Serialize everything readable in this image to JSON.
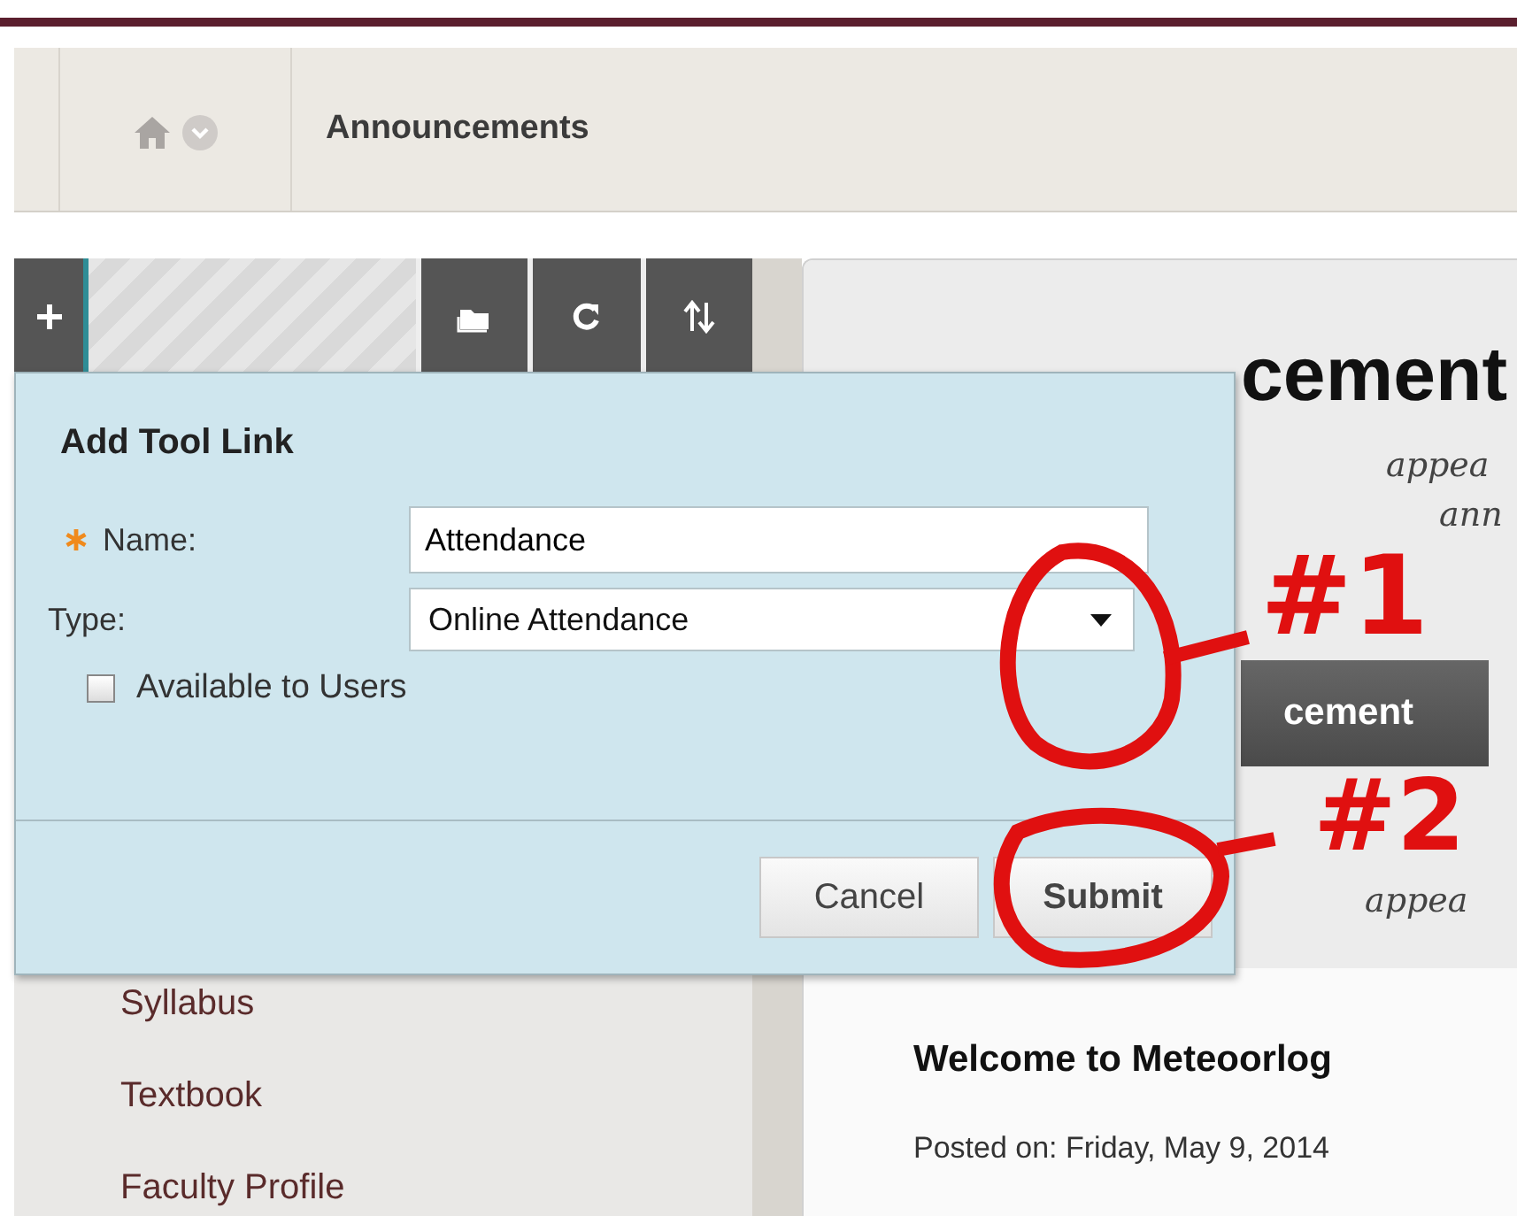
{
  "breadcrumb": {
    "title": "Announcements"
  },
  "sidebar": {
    "items": [
      {
        "label": "Syllabus"
      },
      {
        "label": "Textbook"
      },
      {
        "label": "Faculty Profile"
      }
    ]
  },
  "content": {
    "heading": "cement",
    "notes": [
      "appea",
      "ann"
    ],
    "create_button": "cement",
    "note_below": "appea",
    "post_title": "Welcome to Meteoorlog",
    "posted": "Posted on: Friday, May 9, 2014"
  },
  "dialog": {
    "title": "Add Tool Link",
    "fields": [
      {
        "kind": "text",
        "label": "Name:",
        "required": true,
        "value": "Attendance"
      },
      {
        "kind": "select",
        "label": "Type:",
        "required": false,
        "value": "Online Attendance"
      }
    ],
    "checkbox": {
      "label": "Available to Users",
      "checked": false
    },
    "buttons": [
      "Cancel",
      "Submit"
    ]
  },
  "annotations": [
    {
      "label": "#1"
    },
    {
      "label": "#2"
    }
  ]
}
